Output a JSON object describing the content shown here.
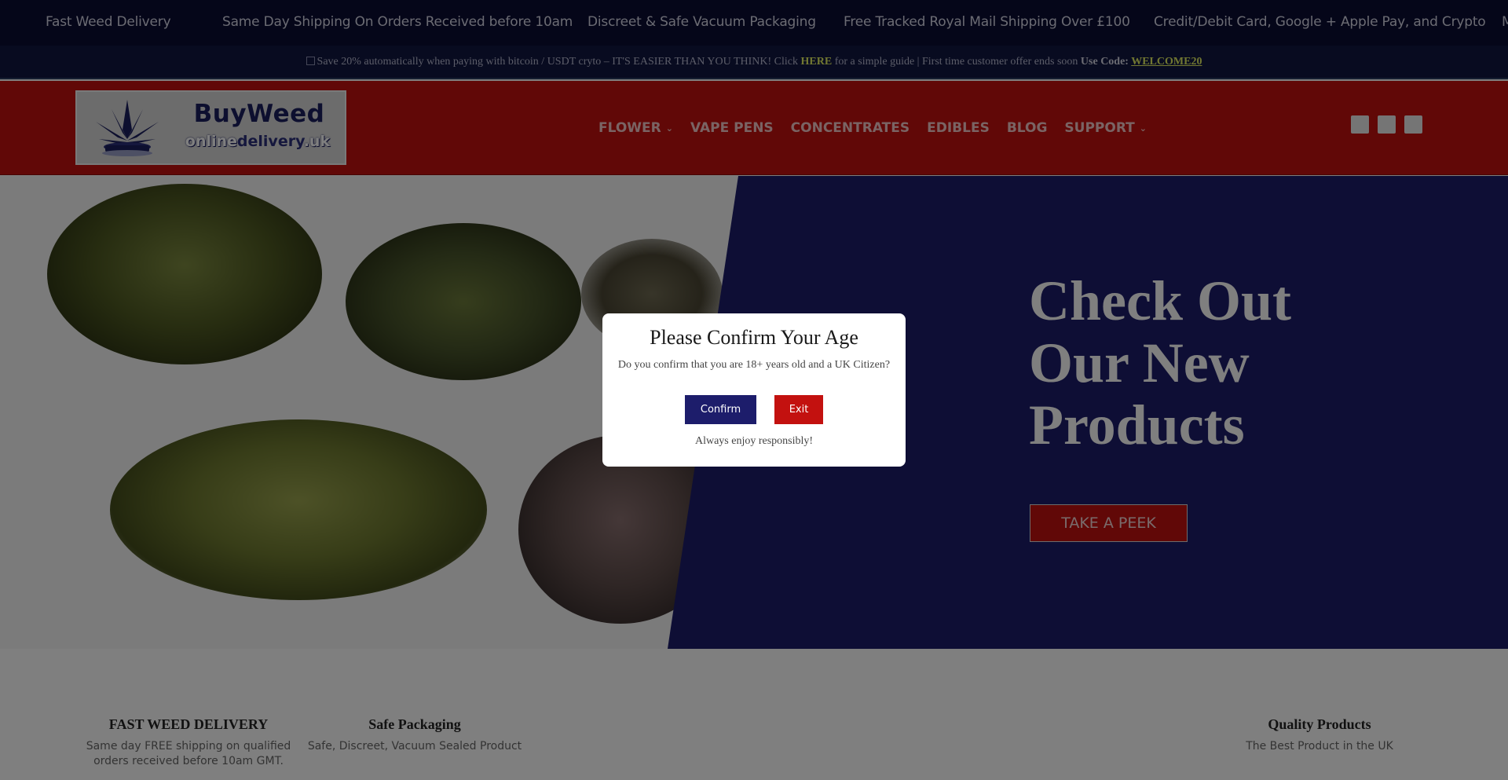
{
  "ticker": {
    "items": [
      "Fast Weed Delivery",
      "Same Day Shipping On Orders Received before 10am",
      "Discreet & Safe Vacuum Packaging",
      "Free Tracked Royal Mail Shipping Over £100",
      "Credit/Debit Card, Google + Apple Pay, and Crypto",
      "M"
    ]
  },
  "promo": {
    "text_before_link": "Save 20% automatically when paying with bitcoin / USDT cryto – IT'S EASIER THAN YOU THINK! Click ",
    "link_label": "HERE",
    "text_after_link": " for a simple guide  | First time customer offer ends soon ",
    "code_prefix": "Use Code: ",
    "code": "WELCOME20"
  },
  "header": {
    "logo": {
      "line1": "BuyWeed",
      "line2_start": "online",
      "line2_highlight": "delivery",
      "line2_end": ".uk"
    },
    "nav": [
      {
        "label": "FLOWER",
        "has_dropdown": true
      },
      {
        "label": "VAPE PENS",
        "has_dropdown": false
      },
      {
        "label": "CONCENTRATES",
        "has_dropdown": false
      },
      {
        "label": "EDIBLES",
        "has_dropdown": false
      },
      {
        "label": "BLOG",
        "has_dropdown": false
      },
      {
        "label": "SUPPORT",
        "has_dropdown": true
      }
    ],
    "icons": [
      "account-icon",
      "search-icon",
      "cart-icon"
    ]
  },
  "hero": {
    "title": "Check Out Our New Products",
    "button_label": "TAKE A PEEK"
  },
  "features": [
    {
      "title": "FAST WEED DELIVERY",
      "text": "Same day FREE shipping on qualified orders received before 10am GMT."
    },
    {
      "title": "Safe Packaging",
      "text": "Safe, Discreet, Vacuum Sealed Product"
    },
    {
      "title": "Quality Products",
      "text": "The Best Product in the UK"
    }
  ],
  "age_modal": {
    "title": "Please Confirm Your Age",
    "message": "Do you confirm that you are 18+ years old and a UK Citizen?",
    "confirm_label": "Confirm",
    "exit_label": "Exit",
    "footer": "Always enjoy responsibly!"
  },
  "colors": {
    "brand_red": "#c3110f",
    "brand_navy": "#1d1d6b",
    "ticker_bg": "#0b0d33",
    "promo_highlight": "#e2ef63"
  }
}
